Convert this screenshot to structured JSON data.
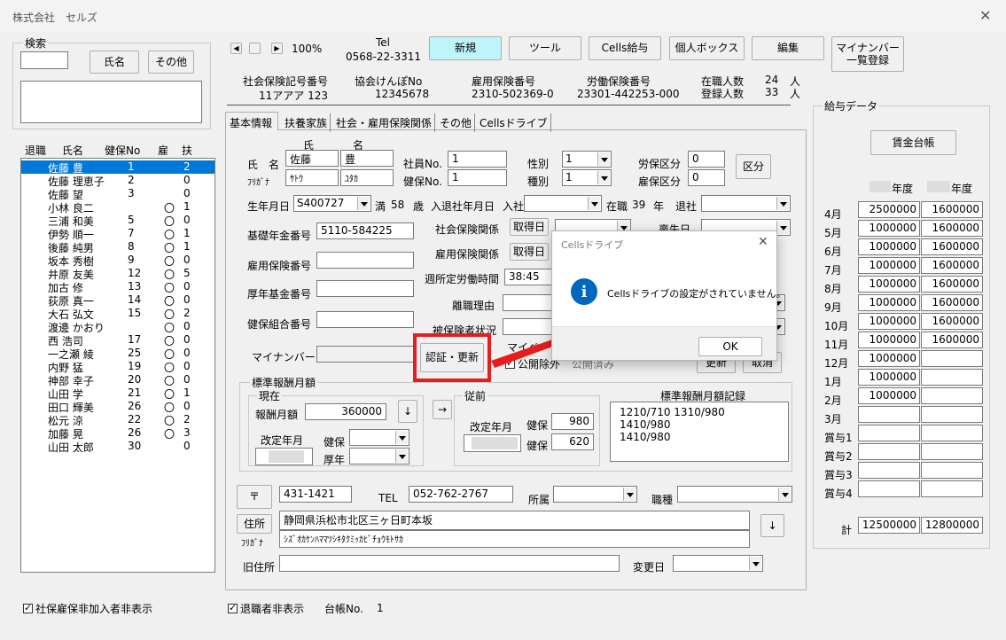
{
  "window": {
    "title": "株式会社　セルズ"
  },
  "search": {
    "group_label": "検索",
    "name_button": "氏名",
    "other_button": "その他"
  },
  "employee_list": {
    "headers": [
      "退職",
      "氏名",
      "健保No",
      "雇",
      "扶"
    ],
    "rows": [
      {
        "name": "佐藤 豊",
        "no": "1",
        "koyo": "",
        "fuyo": "2",
        "selected": true
      },
      {
        "name": "佐藤 理恵子",
        "no": "2",
        "koyo": "",
        "fuyo": "0"
      },
      {
        "name": "佐藤 望",
        "no": "3",
        "koyo": "",
        "fuyo": "0"
      },
      {
        "name": "小林 良二",
        "no": "",
        "koyo": "〇",
        "fuyo": "1"
      },
      {
        "name": "三浦 和美",
        "no": "5",
        "koyo": "〇",
        "fuyo": "0"
      },
      {
        "name": "伊勢 順一",
        "no": "7",
        "koyo": "〇",
        "fuyo": "1"
      },
      {
        "name": "後藤 純男",
        "no": "8",
        "koyo": "〇",
        "fuyo": "1"
      },
      {
        "name": "坂本 秀樹",
        "no": "9",
        "koyo": "〇",
        "fuyo": "0"
      },
      {
        "name": "井原 友美",
        "no": "12",
        "koyo": "〇",
        "fuyo": "5"
      },
      {
        "name": "加古 修",
        "no": "13",
        "koyo": "〇",
        "fuyo": "0"
      },
      {
        "name": "荻原 真一",
        "no": "14",
        "koyo": "〇",
        "fuyo": "0"
      },
      {
        "name": "大石 弘文",
        "no": "15",
        "koyo": "〇",
        "fuyo": "2"
      },
      {
        "name": "渡邊 かおり",
        "no": "",
        "koyo": "〇",
        "fuyo": "0"
      },
      {
        "name": "西 浩司",
        "no": "17",
        "koyo": "〇",
        "fuyo": "0"
      },
      {
        "name": "一之瀬 綾",
        "no": "25",
        "koyo": "〇",
        "fuyo": "0"
      },
      {
        "name": "内野 猛",
        "no": "19",
        "koyo": "〇",
        "fuyo": "0"
      },
      {
        "name": "神部 幸子",
        "no": "20",
        "koyo": "〇",
        "fuyo": "0"
      },
      {
        "name": "山田 学",
        "no": "21",
        "koyo": "〇",
        "fuyo": "1"
      },
      {
        "name": "田口 輝美",
        "no": "26",
        "koyo": "〇",
        "fuyo": "0"
      },
      {
        "name": "松元 涼",
        "no": "22",
        "koyo": "〇",
        "fuyo": "2"
      },
      {
        "name": "加藤 晃",
        "no": "26",
        "koyo": "〇",
        "fuyo": "3"
      },
      {
        "name": "山田 太郎",
        "no": "30",
        "koyo": "",
        "fuyo": "0"
      }
    ]
  },
  "bottom": {
    "hide_non_members": "社保雇保非加入者非表示",
    "hide_retired": "退職者非表示",
    "ledger_label": "台帳No.",
    "ledger_value": "1"
  },
  "toolbar": {
    "zoom": "100%",
    "tel_label": "Tel",
    "tel_value": "0568-22-3311",
    "new": "新規",
    "tool": "ツール",
    "cells_pay": "Cells給与",
    "personal_box": "個人ボックス",
    "edit": "編集",
    "mynumber_reg_1": "マイナンバー",
    "mynumber_reg_2": "一覧登録"
  },
  "company_info": {
    "shaho_label": "社会保険記号番号",
    "shaho_value": "11アアア 123",
    "kenpo_label": "協会けんぽNo",
    "kenpo_value": "12345678",
    "koyo_label": "雇用保険番号",
    "koyo_value": "2310-502369-0",
    "rodo_label": "労働保険番号",
    "rodo_value": "23301-442253-000",
    "enrolled_label": "在職人数",
    "enrolled_value": "24",
    "registered_label": "登録人数",
    "registered_value": "33",
    "unit": "人"
  },
  "tabs": [
    "基本情報",
    "扶養家族",
    "社会・雇用保険関係",
    "その他",
    "Cellsドライブ"
  ],
  "basic": {
    "name_label": "氏　名",
    "kana_label": "ﾌﾘｶﾞﾅ",
    "sei_head": "氏",
    "mei_head": "名",
    "sei": "佐藤",
    "mei": "豊",
    "sei_kana": "ｻﾄｳ",
    "mei_kana": "ﾕﾀｶ",
    "emp_no_label": "社員No.",
    "emp_no": "1",
    "kenpo_no_label": "健保No.",
    "kenpo_no": "1",
    "sex_label": "性別",
    "sex": "1",
    "type_label": "種別",
    "type": "1",
    "rodo_kubun_label": "労保区分",
    "rodo_kubun": "0",
    "koyo_kubun_label": "雇保区分",
    "koyo_kubun": "0",
    "kubun_button": "区分",
    "birth_label": "生年月日",
    "birth": "S400727",
    "age_prefix": "満",
    "age": "58",
    "age_unit": "歳",
    "join_label": "入退社年月日",
    "join_kind": "入社",
    "tenure_label": "在職",
    "tenure": "39",
    "tenure_unit": "年",
    "retire_label": "退社",
    "pension_label": "基礎年金番号",
    "pension": "5110-584225",
    "shaho_rel_label": "社会保険関係",
    "acquire": "取得日",
    "loss": "喪失日",
    "koyo_rel_label": "雇用保険関係",
    "koyo_no_label": "雇用保険番号",
    "weekly_label": "週所定労働時間",
    "weekly": "38:45",
    "kosei_label": "厚年基金番号",
    "rishoku_label": "離職理由",
    "kumiai_label": "健保組合番号",
    "hihoken_label": "被保険者状況",
    "mynumber_label": "マイナンバー",
    "auth_button": "認証・更新",
    "mypage_label": "マイペー",
    "public_label": "公開除外",
    "mypage_status": "公開済み",
    "extra_btn1": "更新",
    "extra_btn2": "取消"
  },
  "standard": {
    "group": "標準報酬月額",
    "current": "現在",
    "monthly_label": "報酬月額",
    "monthly": "360000",
    "revised_label": "改定年月",
    "kenpo": "健保",
    "kosei": "厚年",
    "prev": "従前",
    "prev_revised": "改定年月",
    "prev_kenpo": "980",
    "prev_kosei": "620",
    "history_label": "標準報酬月額記録",
    "history_line1": "1210/710  1310/980 1410/980",
    "history_line2": "1410/980"
  },
  "address": {
    "zip_button": "〒",
    "zip": "431-1421",
    "tel_label": "TEL",
    "tel": "052-762-2767",
    "dept_label": "所属",
    "job_label": "職種",
    "addr_button": "住所",
    "kana_label": "ﾌﾘｶﾞﾅ",
    "addr": "静岡県浜松市北区三ヶ日町本坂",
    "addr_kana": "ｼｽﾞｵｶｹﾝﾊﾏﾏﾂｼｷﾀｸﾐｯｶﾋﾞﾁｮｳﾓﾄｻｶ",
    "old_label": "旧住所",
    "change_label": "変更日"
  },
  "salary": {
    "group": "給与データ",
    "ledger_button": "賃金台帳",
    "year_suffix": "年度",
    "rows": [
      {
        "m": "4月",
        "a": "2500000",
        "b": "1600000"
      },
      {
        "m": "5月",
        "a": "1000000",
        "b": "1600000"
      },
      {
        "m": "6月",
        "a": "1000000",
        "b": "1600000"
      },
      {
        "m": "7月",
        "a": "1000000",
        "b": "1600000"
      },
      {
        "m": "8月",
        "a": "1000000",
        "b": "1600000"
      },
      {
        "m": "9月",
        "a": "1000000",
        "b": "1600000"
      },
      {
        "m": "10月",
        "a": "1000000",
        "b": "1600000"
      },
      {
        "m": "11月",
        "a": "1000000",
        "b": "1600000"
      },
      {
        "m": "12月",
        "a": "1000000",
        "b": ""
      },
      {
        "m": "1月",
        "a": "1000000",
        "b": ""
      },
      {
        "m": "2月",
        "a": "1000000",
        "b": ""
      },
      {
        "m": "3月",
        "a": "",
        "b": ""
      },
      {
        "m": "賞与1",
        "a": "",
        "b": ""
      },
      {
        "m": "賞与2",
        "a": "",
        "b": ""
      },
      {
        "m": "賞与3",
        "a": "",
        "b": ""
      },
      {
        "m": "賞与4",
        "a": "",
        "b": ""
      }
    ],
    "total_label": "計",
    "total_a": "12500000",
    "total_b": "12800000"
  },
  "dialog": {
    "title": "Cellsドライブ",
    "message": "Cellsドライブの設定がされていません。",
    "ok": "OK"
  },
  "colors": {
    "accent_btn": "#bff5fa",
    "highlight": "#e81c1c",
    "selection": "#0078d7",
    "info": "#0067c0"
  }
}
